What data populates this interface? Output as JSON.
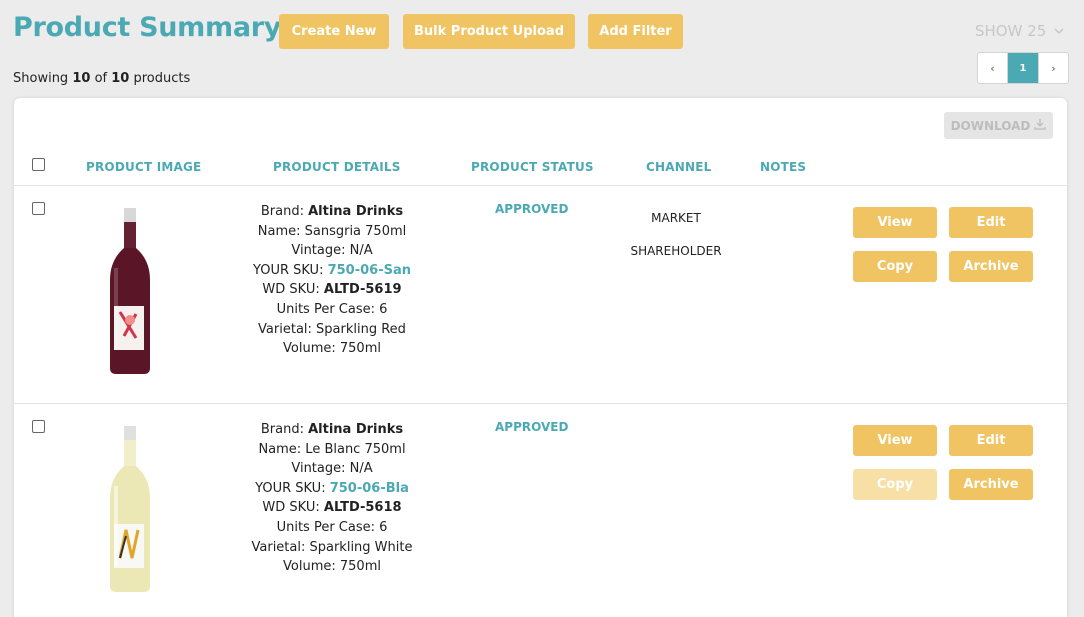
{
  "header": {
    "title": "Product Summary",
    "create_label": "Create New",
    "bulk_label": "Bulk Product Upload",
    "filter_label": "Add Filter",
    "show_label": "SHOW 25"
  },
  "summary": {
    "prefix": "Showing",
    "shown": "10",
    "of": "of",
    "total": "10",
    "suffix": "products"
  },
  "pagination": {
    "prev": "‹",
    "current": "1",
    "next": "›"
  },
  "table": {
    "download_label": "DOWNLOAD",
    "columns": [
      "PRODUCT IMAGE",
      "PRODUCT DETAILS",
      "PRODUCT STATUS",
      "CHANNEL",
      "NOTES"
    ],
    "rows": [
      {
        "brand_label": "Brand:",
        "brand": "Altina Drinks",
        "name": "Name: Sansgria 750ml",
        "vintage": "Vintage: N/A",
        "your_sku_label": "YOUR SKU:",
        "your_sku": "750-06-San",
        "wd_sku_label": "WD SKU:",
        "wd_sku": "ALTD-5619",
        "units": "Units Per Case: 6",
        "varietal": "Varietal: Sparkling Red",
        "volume": "Volume: 750ml",
        "status": "APPROVED",
        "channels": [
          "MARKET",
          "SHAREHOLDER"
        ],
        "actions": {
          "view": "View",
          "edit": "Edit",
          "copy": "Copy",
          "archive": "Archive"
        }
      },
      {
        "brand_label": "Brand:",
        "brand": "Altina Drinks",
        "name": "Name: Le Blanc 750ml",
        "vintage": "Vintage: N/A",
        "your_sku_label": "YOUR SKU:",
        "your_sku": "750-06-Bla",
        "wd_sku_label": "WD SKU:",
        "wd_sku": "ALTD-5618",
        "units": "Units Per Case: 6",
        "varietal": "Varietal: Sparkling White",
        "volume": "Volume: 750ml",
        "status": "APPROVED",
        "channels": [],
        "actions": {
          "view": "View",
          "edit": "Edit",
          "copy": "Copy",
          "archive": "Archive"
        }
      }
    ]
  },
  "colors": {
    "accent": "#4ba9b4",
    "button": "#f0c463",
    "button_disabled": "#f7dfa6",
    "red_wine": "#5a1626",
    "white_wine": "#ece8b6"
  }
}
